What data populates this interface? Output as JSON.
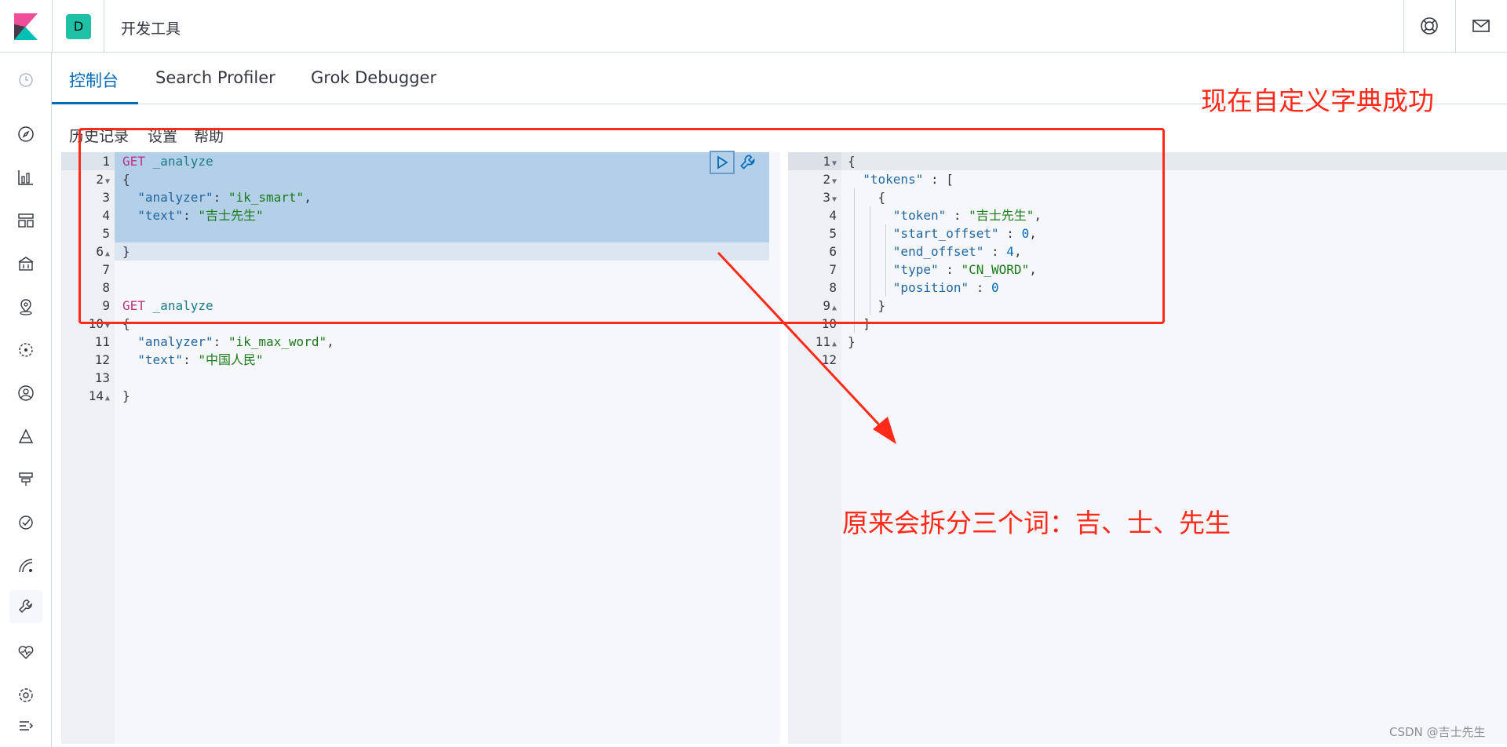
{
  "topbar": {
    "space_initial": "D",
    "breadcrumb": "开发工具",
    "help_icon": "lifebuoy-icon",
    "mail_icon": "mail-icon"
  },
  "tabs": [
    {
      "label": "控制台",
      "active": true
    },
    {
      "label": "Search Profiler",
      "active": false
    },
    {
      "label": "Grok Debugger",
      "active": false
    }
  ],
  "menu": {
    "history": "历史记录",
    "settings": "设置",
    "help": "帮助"
  },
  "request": {
    "line1": {
      "method": "GET",
      "path": "_analyze"
    },
    "line3": {
      "key": "\"analyzer\"",
      "val": "\"ik_smart\""
    },
    "line4": {
      "key": "\"text\"",
      "val": "\"吉士先生\""
    },
    "line9": {
      "method": "GET",
      "path": "_analyze"
    },
    "line11": {
      "key": "\"analyzer\"",
      "val": "\"ik_max_word\""
    },
    "line12": {
      "key": "\"text\"",
      "val": "\"中国人民\""
    },
    "line_numbers": [
      "1",
      "2",
      "3",
      "4",
      "5",
      "6",
      "7",
      "8",
      "9",
      "10",
      "11",
      "12",
      "13",
      "14"
    ]
  },
  "response": {
    "tokens_key": "\"tokens\"",
    "token_key": "\"token\"",
    "token_val": "\"吉士先生\"",
    "start_key": "\"start_offset\"",
    "start_val": "0",
    "end_key": "\"end_offset\"",
    "end_val": "4",
    "type_key": "\"type\"",
    "type_val": "\"CN_WORD\"",
    "pos_key": "\"position\"",
    "pos_val": "0",
    "line_numbers": [
      "1",
      "2",
      "3",
      "4",
      "5",
      "6",
      "7",
      "8",
      "9",
      "10",
      "11",
      "12"
    ]
  },
  "annotations": {
    "title": "现在自定义字典成功",
    "body": "原来会拆分三个词：吉、士、先生"
  },
  "watermark": "CSDN @吉士先生",
  "colors": {
    "accent": "#006bb8",
    "annotation": "#ff2a1a",
    "selection": "#b3d0e8"
  }
}
